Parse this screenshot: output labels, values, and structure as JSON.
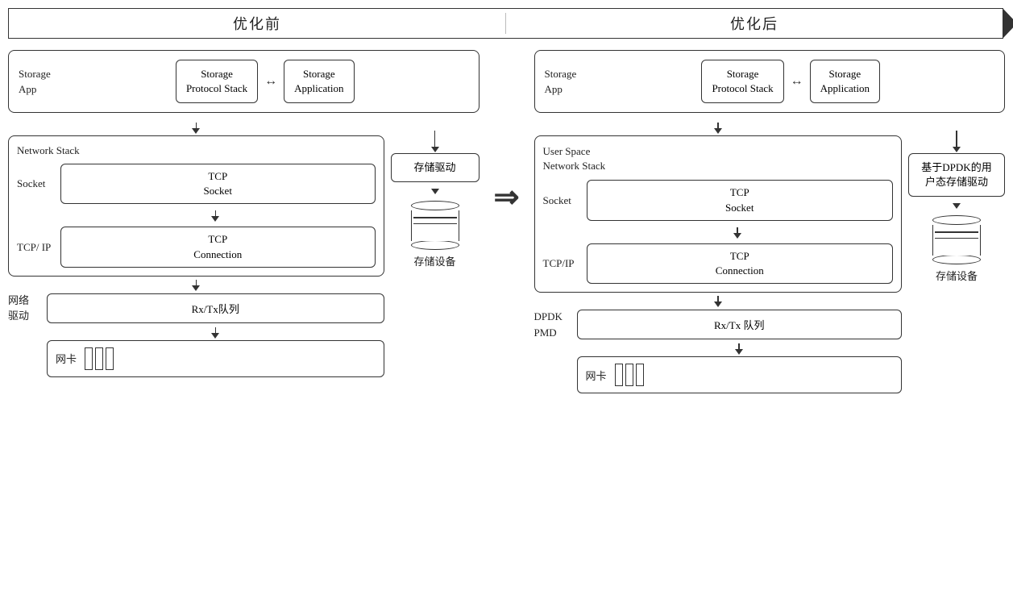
{
  "banner": {
    "before": "优化前",
    "after": "优化后"
  },
  "left": {
    "storage_app": "Storage\nApp",
    "protocol_stack": "Storage\nProtocol Stack",
    "application": "Storage\nApplication",
    "double_arrow": "↔",
    "network_stack_label": "Network Stack",
    "socket_label": "Socket",
    "tcp_socket": "TCP\nSocket",
    "tcpip_label": "TCP/ IP",
    "tcp_connection": "TCP\nConnection",
    "driver_label": "网络\n驱动",
    "rxtx": "Rx/Tx队列",
    "storage_driver": "存储驱动",
    "nic_label": "网卡",
    "storage_device_label": "存储设备"
  },
  "right": {
    "storage_app": "Storage\nApp",
    "protocol_stack": "Storage\nProtocol Stack",
    "application": "Storage\nApplication",
    "double_arrow": "↔",
    "network_stack_label": "User Space\nNetwork Stack",
    "socket_label": "Socket",
    "tcp_socket": "TCP\nSocket",
    "tcpip_label": "TCP/IP",
    "tcp_connection": "TCP\nConnection",
    "dpdk_label": "DPDK\nPMD",
    "rxtx": "Rx/Tx 队列",
    "storage_driver": "基于DPDK的用\n户态存储驱动",
    "nic_label": "网卡",
    "storage_device_label": "存储设备"
  },
  "middle_arrow": "⇒"
}
